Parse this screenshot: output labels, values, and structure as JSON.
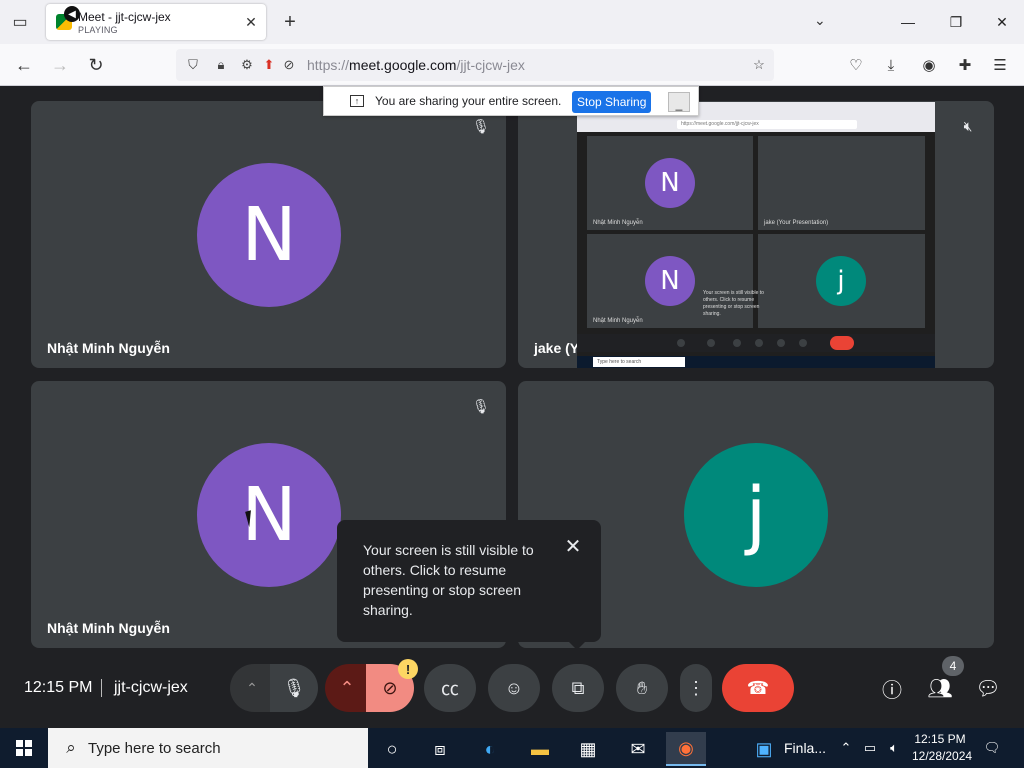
{
  "browser": {
    "tab": {
      "title": "Meet - jjt-cjcw-jex",
      "subtitle": "PLAYING"
    },
    "url": {
      "prefix": "https://",
      "domain": "meet.google.com",
      "path": "/jjt-cjcw-jex"
    }
  },
  "share_bar": {
    "message": "You are sharing your entire screen.",
    "stop_label": "Stop Sharing",
    "hide_label": "_"
  },
  "tiles": [
    {
      "name": "Nhật Minh Nguyễn",
      "initial": "N",
      "color": "#7e57c2"
    },
    {
      "name": "jake (Your Presentation)"
    },
    {
      "name": "Nhật Minh Nguyễn",
      "initial": "N",
      "color": "#7e57c2"
    },
    {
      "initial": "j",
      "color": "#00897b"
    }
  ],
  "preview": {
    "url": "https://meet.google.com/jjt-cjcw-jex",
    "names": [
      "Nhật Minh Nguyễn",
      "jake (Your Presentation)",
      "Nhật Minh Nguyễn"
    ],
    "initials": [
      "N",
      "N",
      "j"
    ],
    "popup": "Your screen is still visible to others. Click to resume presenting or stop screen sharing.",
    "search": "Type here to search"
  },
  "popup": {
    "text": "Your screen is still visible to others. Click to resume presenting or stop screen sharing."
  },
  "controls": {
    "time": "12:15 PM",
    "meeting_code": "jjt-cjcw-jex",
    "camera_warning": "!",
    "people_count": "4",
    "end_call_color": "#ea4335"
  },
  "taskbar": {
    "search_placeholder": "Type here to search",
    "app_label": "Finla...",
    "time": "12:15 PM",
    "date": "12/28/2024"
  }
}
